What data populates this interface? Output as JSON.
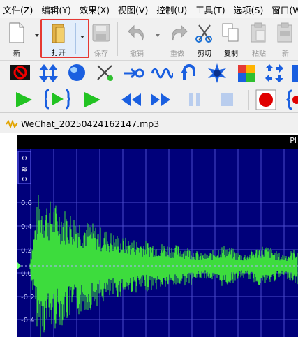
{
  "menu": [
    "文件(Z)",
    "编辑(Y)",
    "效果(X)",
    "视图(V)",
    "控制(U)",
    "工具(T)",
    "选项(S)",
    "窗口(W)"
  ],
  "toolbar": {
    "new_label": "新",
    "open_label": "打开",
    "save_label": "保存",
    "undo_label": "撤销",
    "redo_label": "重做",
    "cut_label": "剪切",
    "copy_label": "复制",
    "paste_label": "粘贴",
    "paste_new_label": "新"
  },
  "document": {
    "title": "WeChat_20250424162147.mp3"
  },
  "waveform": {
    "header_text": "Pl",
    "y_ticks": [
      "0.6",
      "0.4",
      "0.2",
      "0.0",
      "-0.2",
      "-0.4"
    ],
    "color_wave": "#3ddc3d",
    "color_background": "#00007a",
    "color_grid": "#4a4acc"
  },
  "colors": {
    "accent_highlight": "#e53935",
    "play_green": "#22c322",
    "transport_blue": "#1a5fe0",
    "record_red": "#e00000"
  }
}
